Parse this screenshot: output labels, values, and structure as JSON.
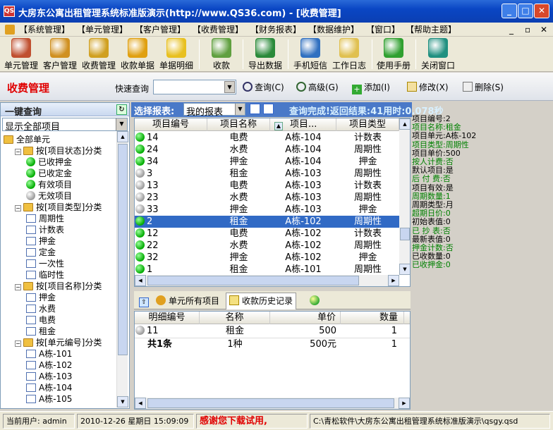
{
  "window": {
    "title": "大房东公寓出租管理系统标准版演示(http://www.QS36.com) - [收费管理]",
    "app_icon_text": "QS",
    "minimize_label": "_",
    "maximize_label": "□",
    "close_label": "✕"
  },
  "menu": {
    "items": [
      "【系统管理】",
      "【单元管理】",
      "【客户管理】",
      "【收费管理】",
      "【财务报表】",
      "【数据维护】",
      "【窗口】",
      "【帮助主题】"
    ],
    "mdi_controls": [
      "_",
      "▫",
      "✕"
    ]
  },
  "toolbar": {
    "buttons": [
      {
        "label": "单元管理",
        "icon": "house-icon",
        "color": "#c05030"
      },
      {
        "label": "客户管理",
        "icon": "people-icon",
        "color": "#d09020"
      },
      {
        "label": "收费管理",
        "icon": "coins-icon",
        "color": "#d0a020"
      },
      {
        "label": "收款单据",
        "icon": "yen-receipt-icon",
        "color": "#e0a010"
      },
      {
        "label": "单据明细",
        "icon": "yen-document-icon",
        "color": "#e8c020"
      },
      {
        "label": "收款",
        "icon": "money-icon",
        "color": "#60a040"
      },
      {
        "label": "导出数据",
        "icon": "excel-icon",
        "color": "#2a8a3a"
      },
      {
        "label": "手机短信",
        "icon": "phone-icon",
        "color": "#3070c0"
      },
      {
        "label": "工作日志",
        "icon": "notebook-icon",
        "color": "#e0c050"
      },
      {
        "label": "使用手册",
        "icon": "help-icon",
        "color": "#30a030"
      },
      {
        "label": "关闭窗口",
        "icon": "exit-door-icon",
        "color": "#209080"
      }
    ]
  },
  "mgmt": {
    "title": "收费管理",
    "quick_label": "快速查询",
    "quick_value": "",
    "actions": [
      {
        "label": "查询(C)",
        "icon": "magnifier-icon"
      },
      {
        "label": "高级(G)",
        "icon": "advanced-search-icon"
      },
      {
        "label": "添加(I)",
        "icon": "add-icon"
      },
      {
        "label": "修改(X)",
        "icon": "edit-pencil-icon"
      },
      {
        "label": "删除(S)",
        "icon": "delete-icon"
      }
    ]
  },
  "left": {
    "header": "一键查询",
    "refresh_icon": "refresh-icon",
    "select_value": "显示全部项目",
    "tree": [
      {
        "label": "全部单元",
        "depth": 0,
        "kind": "folder"
      },
      {
        "label": "按[项目状态]分类",
        "depth": 1,
        "kind": "folder",
        "toggle": "−"
      },
      {
        "label": "已收押金",
        "depth": 2,
        "kind": "green"
      },
      {
        "label": "已收定金",
        "depth": 2,
        "kind": "green"
      },
      {
        "label": "有效项目",
        "depth": 2,
        "kind": "green"
      },
      {
        "label": "无效项目",
        "depth": 2,
        "kind": "grey"
      },
      {
        "label": "按[项目类型]分类",
        "depth": 1,
        "kind": "folder",
        "toggle": "−"
      },
      {
        "label": "周期性",
        "depth": 2,
        "kind": "doc"
      },
      {
        "label": "计数表",
        "depth": 2,
        "kind": "doc"
      },
      {
        "label": "押金",
        "depth": 2,
        "kind": "doc"
      },
      {
        "label": "定金",
        "depth": 2,
        "kind": "doc"
      },
      {
        "label": "一次性",
        "depth": 2,
        "kind": "doc"
      },
      {
        "label": "临时性",
        "depth": 2,
        "kind": "doc"
      },
      {
        "label": "按[项目名称]分类",
        "depth": 1,
        "kind": "folder",
        "toggle": "−"
      },
      {
        "label": "押金",
        "depth": 2,
        "kind": "doc"
      },
      {
        "label": "水费",
        "depth": 2,
        "kind": "doc"
      },
      {
        "label": "电费",
        "depth": 2,
        "kind": "doc"
      },
      {
        "label": "租金",
        "depth": 2,
        "kind": "doc"
      },
      {
        "label": "按[单元编号]分类",
        "depth": 1,
        "kind": "folder",
        "toggle": "−"
      },
      {
        "label": "A栋-101",
        "depth": 2,
        "kind": "doc"
      },
      {
        "label": "A栋-102",
        "depth": 2,
        "kind": "doc"
      },
      {
        "label": "A栋-103",
        "depth": 2,
        "kind": "doc"
      },
      {
        "label": "A栋-104",
        "depth": 2,
        "kind": "doc"
      },
      {
        "label": "A栋-105",
        "depth": 2,
        "kind": "doc"
      }
    ]
  },
  "report": {
    "label": "选择报表:",
    "select_value": "我的报表",
    "status": "查询完成!返回结果:41用时:0.078秒"
  },
  "grid1": {
    "headers": [
      "项目编号",
      "项目名称",
      "项目...",
      "项目类型"
    ],
    "sort_icon": "sort-up-icon",
    "rows": [
      {
        "id": "14",
        "name": "电费",
        "unit": "A栋-104",
        "type": "计数表",
        "status": "green"
      },
      {
        "id": "24",
        "name": "水费",
        "unit": "A栋-104",
        "type": "周期性",
        "status": "green"
      },
      {
        "id": "34",
        "name": "押金",
        "unit": "A栋-104",
        "type": "押金",
        "status": "green"
      },
      {
        "id": "3",
        "name": "租金",
        "unit": "A栋-103",
        "type": "周期性",
        "status": "grey"
      },
      {
        "id": "13",
        "name": "电费",
        "unit": "A栋-103",
        "type": "计数表",
        "status": "grey"
      },
      {
        "id": "23",
        "name": "水费",
        "unit": "A栋-103",
        "type": "周期性",
        "status": "grey"
      },
      {
        "id": "33",
        "name": "押金",
        "unit": "A栋-103",
        "type": "押金",
        "status": "grey"
      },
      {
        "id": "2",
        "name": "租金",
        "unit": "A栋-102",
        "type": "周期性",
        "status": "green",
        "selected": true
      },
      {
        "id": "12",
        "name": "电费",
        "unit": "A栋-102",
        "type": "计数表",
        "status": "green"
      },
      {
        "id": "22",
        "name": "水费",
        "unit": "A栋-102",
        "type": "周期性",
        "status": "green"
      },
      {
        "id": "32",
        "name": "押金",
        "unit": "A栋-102",
        "type": "押金",
        "status": "green"
      },
      {
        "id": "1",
        "name": "租金",
        "unit": "A栋-101",
        "type": "周期性",
        "status": "green"
      }
    ]
  },
  "tabs": [
    {
      "label": "单元所有项目",
      "icon": "coins-small-icon"
    },
    {
      "label": "收款历史记录",
      "icon": "receipt-small-icon",
      "active": true
    }
  ],
  "grid2": {
    "headers": [
      "明细编号",
      "名称",
      "单价",
      "数量"
    ],
    "rows": [
      {
        "id": "11",
        "name": "租金",
        "price": "500",
        "qty": "1"
      }
    ],
    "summary": {
      "id": "共1条",
      "name": "1种",
      "price": "500元",
      "qty": "1"
    }
  },
  "detail": [
    {
      "text": "项目编号:2",
      "green": false
    },
    {
      "text": "项目名称:租金",
      "green": true
    },
    {
      "text": "项目单元:A栋-102",
      "green": false
    },
    {
      "text": "项目类型:周期性",
      "green": true
    },
    {
      "text": "项目单价:500",
      "green": false
    },
    {
      "text": "按人计费:否",
      "green": true
    },
    {
      "text": "默认项目:是",
      "green": false
    },
    {
      "text": "后 付 费:否",
      "green": true
    },
    {
      "text": "项目有效:是",
      "green": false
    },
    {
      "text": "周期数量:1",
      "green": true
    },
    {
      "text": "周期类型:月",
      "green": false
    },
    {
      "text": "超期日价:0",
      "green": true
    },
    {
      "text": "初始表值:0",
      "green": false
    },
    {
      "text": "已 抄 表:否",
      "green": true
    },
    {
      "text": "最新表值:0",
      "green": false
    },
    {
      "text": "押金计数:否",
      "green": true
    },
    {
      "text": "已收数量:0",
      "green": false
    },
    {
      "text": "已收押金:0",
      "green": true
    }
  ],
  "statusbar": {
    "user": "当前用户: admin",
    "datetime": "2010-12-26 星期日 15:09:09",
    "thanks": "感谢您下载试用,",
    "path": "C:\\青松软件\\大房东公寓出租管理系统标准版演示\\qsgy.qsd"
  }
}
